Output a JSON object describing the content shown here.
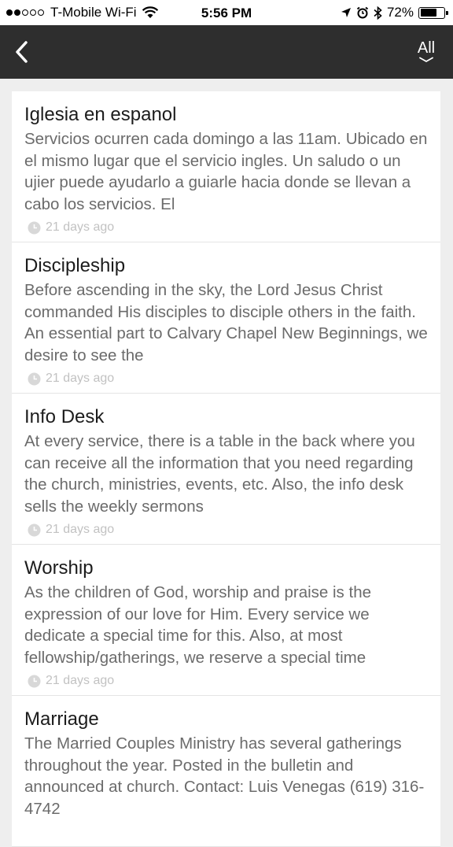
{
  "status_bar": {
    "carrier": "T-Mobile Wi-Fi",
    "time": "5:56 PM",
    "battery": "72%",
    "battery_level": 0.72,
    "signal_bars_filled": 2,
    "signal_bars_total": 5,
    "icons": [
      "wifi-icon",
      "location-arrow-icon",
      "alarm-icon",
      "bluetooth-icon",
      "battery-icon"
    ]
  },
  "nav": {
    "back_icon": "chevron-left-icon",
    "filter_label": "All",
    "filter_icon": "chevron-down-icon"
  },
  "items": [
    {
      "title": "Iglesia en espanol",
      "body": "Servicios ocurren cada domingo a las 11am. Ubicado en el mismo lugar que el servicio ingles. Un saludo o un ujier puede ayudarlo a guiarle hacia donde se llevan a cabo los servicios. El",
      "time": "21 days ago"
    },
    {
      "title": "Discipleship",
      "body": "Before ascending in the sky, the Lord Jesus Christ commanded His disciples to disciple others in the faith. An essential part to Calvary Chapel New Beginnings, we desire to see the",
      "time": "21 days ago"
    },
    {
      "title": "Info Desk",
      "body": "At every service, there is a table in the back where you can receive all the information that you need regarding the church, ministries, events, etc. Also, the info desk sells the weekly sermons",
      "time": "21 days ago"
    },
    {
      "title": "Worship",
      "body": "As the children of God, worship and praise is the expression of our love for Him. Every service we dedicate a special time for this. Also, at most fellowship/gatherings, we reserve a special time",
      "time": "21 days ago"
    },
    {
      "title": "Marriage",
      "body": "The Married Couples Ministry has several gatherings throughout the year. Posted in the bulletin and announced at church. Contact: Luis Venegas (619) 316-4742",
      "time": ""
    }
  ],
  "colors": {
    "nav_background": "#2e2e2e",
    "page_background": "#eeeeee",
    "card_background": "#ffffff",
    "title_text": "#1c1c1c",
    "body_text": "#6b6b6b",
    "meta_text": "#c2c2c2"
  }
}
